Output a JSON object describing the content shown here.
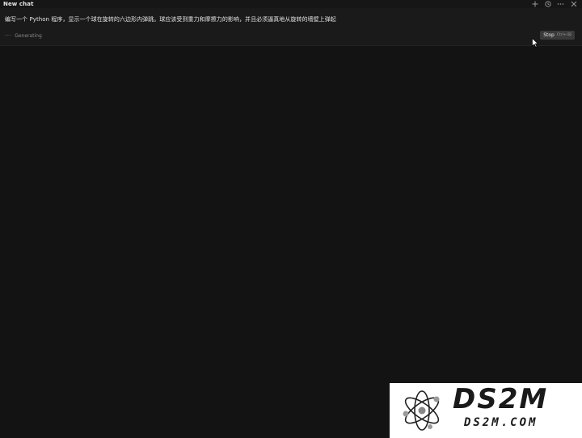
{
  "window": {
    "title": "New chat"
  },
  "toolbar": {
    "icons": [
      "plus-icon",
      "history-icon",
      "more-icon",
      "close-icon"
    ]
  },
  "prompt": {
    "text": "编写一个 Python 程序，显示一个球在旋转的六边形内弹跳。球应该受到重力和摩擦力的影响，并且必须逼真地从旋转的墙壁上弹起"
  },
  "status": {
    "text": "Generating"
  },
  "stop_button": {
    "label": "Stop",
    "shortcut": "Ctrl+⌫"
  },
  "watermark": {
    "title": "DS2M",
    "domain": "DS2M.COM"
  },
  "colors": {
    "background": "#131313",
    "prompt_bg": "#1a1a1a",
    "button_bg": "#3a3a3a",
    "text": "#e4e4e4",
    "muted": "#8a8a8a"
  }
}
